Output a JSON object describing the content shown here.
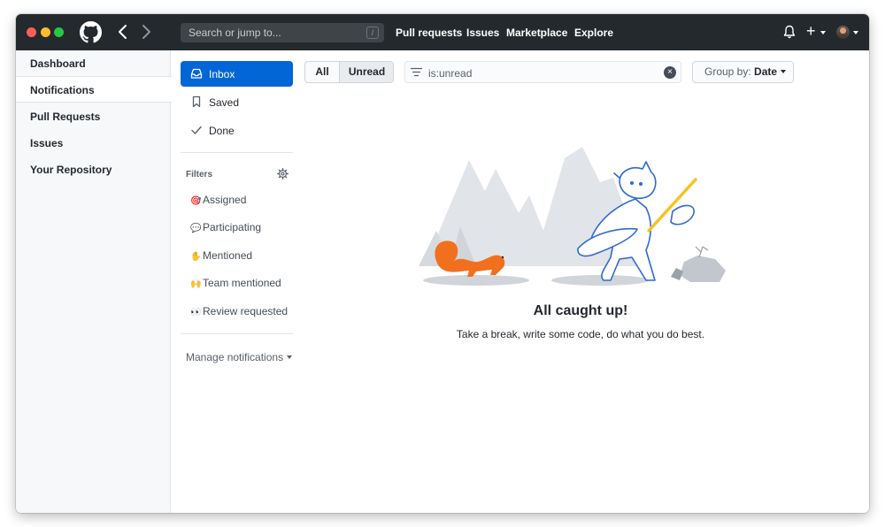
{
  "topbar": {
    "search_placeholder": "Search or jump to...",
    "search_shortcut": "/",
    "nav": [
      "Pull requests",
      "Issues",
      "Marketplace",
      "Explore"
    ],
    "plus": "+"
  },
  "sidebar": {
    "items": [
      "Dashboard",
      "Notifications",
      "Pull Requests",
      "Issues",
      "Your Repository"
    ],
    "selected": "Notifications"
  },
  "notif_nav": {
    "items": [
      {
        "label": "Inbox",
        "icon": "inbox-icon",
        "active": true
      },
      {
        "label": "Saved",
        "icon": "bookmark-icon",
        "active": false
      },
      {
        "label": "Done",
        "icon": "check-icon",
        "active": false
      }
    ]
  },
  "filters": {
    "heading": "Filters",
    "items": [
      {
        "emoji": "🎯",
        "label": "Assigned"
      },
      {
        "emoji": "💬",
        "label": "Participating"
      },
      {
        "emoji": "✋",
        "label": "Mentioned"
      },
      {
        "emoji": "🙌",
        "label": "Team mentioned"
      },
      {
        "emoji": "👀",
        "label": "Review requested"
      }
    ],
    "manage": "Manage notifications"
  },
  "toolbar": {
    "all": "All",
    "unread": "Unread",
    "filter_value": "is:unread",
    "clear": "×",
    "groupby_label": "Group by:",
    "groupby_value": "Date"
  },
  "empty": {
    "title": "All caught up!",
    "subtitle": "Take a break, write some code, do what you do best."
  },
  "colors": {
    "header_bg": "#24292e",
    "accent": "#0366d6",
    "squirrel": "#f2701d",
    "paddle": "#f5c324"
  }
}
